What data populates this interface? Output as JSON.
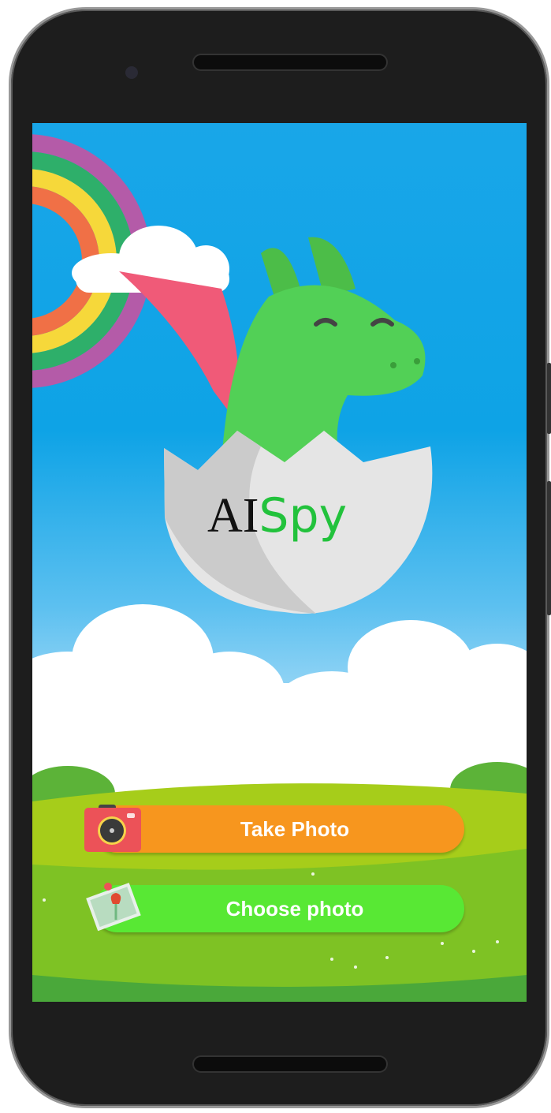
{
  "app": {
    "logo_ai": "AI",
    "logo_spy": "Spy"
  },
  "buttons": {
    "take_photo": "Take Photo",
    "choose_photo": "Choose photo"
  },
  "icons": {
    "take_photo": "camera-icon",
    "choose_photo": "photo-gallery-icon"
  },
  "colors": {
    "take_photo": "#f7961e",
    "choose_photo": "#58e834",
    "sky": "#0ea3e6",
    "grass": "#7ec224"
  }
}
